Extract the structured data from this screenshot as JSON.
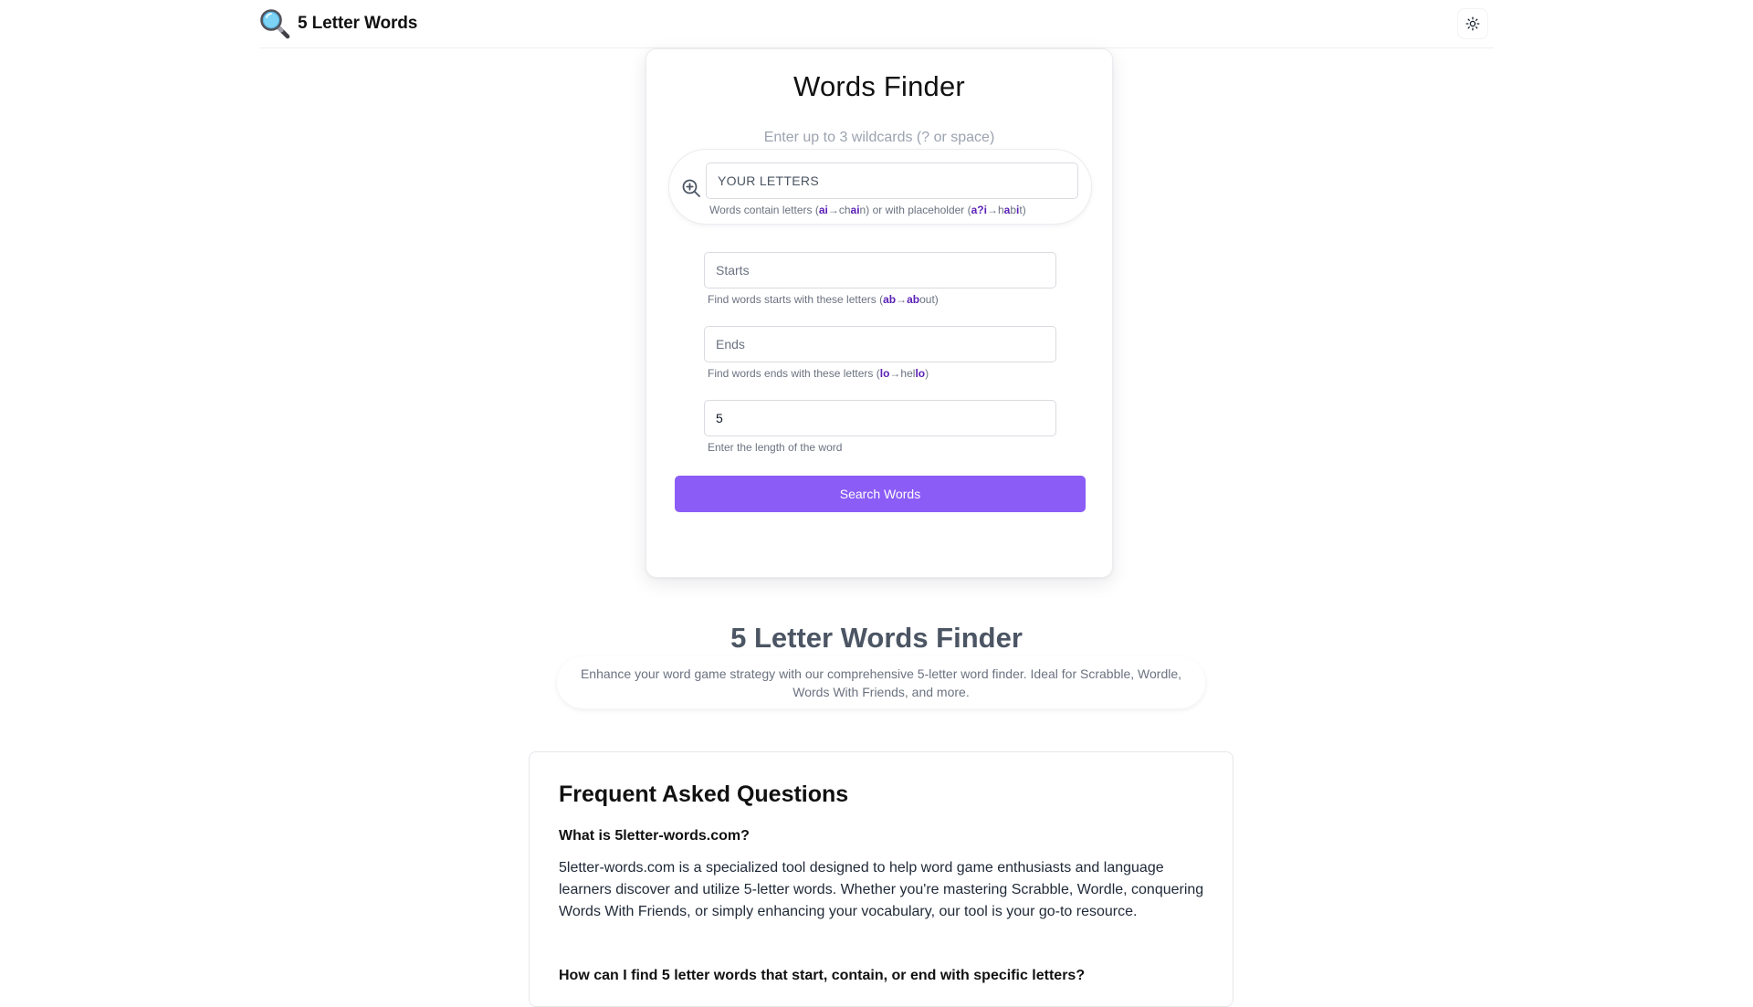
{
  "header": {
    "brand_title": "5 Letter Words"
  },
  "finder": {
    "title": "Words Finder",
    "wildcard_hint": "Enter up to 3 wildcards (? or space)",
    "letters": {
      "placeholder": "YOUR LETTERS",
      "value": "",
      "help_prefix": "Words contain letters (",
      "help_ex1_pattern": "ai",
      "help_ex1_pre": "ch",
      "help_ex1_match": "ai",
      "help_ex1_post": "n",
      "help_mid": ") or with placeholder (",
      "help_ex2_pattern": "a?i",
      "help_ex2_h": "h",
      "help_ex2_a": "a",
      "help_ex2_b": "b",
      "help_ex2_i": "i",
      "help_ex2_t": "t",
      "help_suffix": ")"
    },
    "starts": {
      "placeholder": "Starts",
      "value": "",
      "help_prefix": "Find words starts with these letters (",
      "help_pattern": "ab",
      "help_match": "ab",
      "help_rest": "out",
      "help_suffix": ")"
    },
    "ends": {
      "placeholder": "Ends",
      "value": "",
      "help_prefix": "Find words ends with these letters (",
      "help_pattern": "lo",
      "help_pre": "hel",
      "help_match": "lo",
      "help_suffix": ")"
    },
    "length": {
      "value": "5",
      "help": "Enter the length of the word"
    },
    "arrow": "→",
    "search_label": "Search Words"
  },
  "intro": {
    "title": "5 Letter Words Finder",
    "text": "Enhance your word game strategy with our comprehensive 5-letter word finder. Ideal for Scrabble, Wordle, Words With Friends, and more."
  },
  "faq": {
    "title": "Frequent Asked Questions",
    "items": [
      {
        "question": "What is 5letter-words.com?",
        "answer": "5letter-words.com is a specialized tool designed to help word game enthusiasts and language learners discover and utilize 5-letter words. Whether you're mastering Scrabble, Wordle, conquering Words With Friends, or simply enhancing your vocabulary, our tool is your go-to resource."
      },
      {
        "question": "How can I find 5 letter words that start, contain, or end with specific letters?",
        "answer": ""
      }
    ]
  },
  "icons": {
    "brand": "magnifying-glass-icon",
    "theme": "sun-icon",
    "letters": "zoom-in-icon"
  },
  "colors": {
    "accent": "#8b5cf6",
    "highlight": "#5b21b6",
    "muted_text": "#6b7280"
  }
}
